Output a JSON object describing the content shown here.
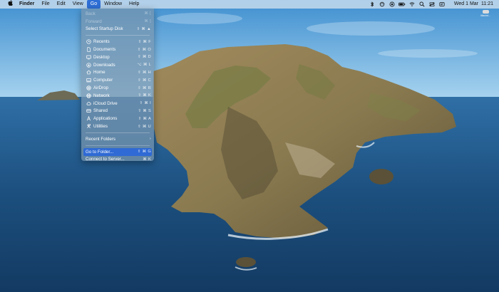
{
  "menubar": {
    "apple_icon": "apple-icon",
    "app_name": "Finder",
    "menus": [
      "File",
      "Edit",
      "View",
      "Go",
      "Window",
      "Help"
    ],
    "active_menu": "Go",
    "status_icons": [
      "bluetooth-icon",
      "siri-icon",
      "screen-record-icon",
      "battery-icon",
      "wifi-icon",
      "search-icon",
      "control-center-icon",
      "notification-icon"
    ],
    "date": "Wed 1 Mar",
    "time": "11:21"
  },
  "go_menu": {
    "items": [
      {
        "label": "Back",
        "shortcut": "⌘ [",
        "icon": "",
        "enabled": false
      },
      {
        "label": "Forward",
        "shortcut": "⌘ ]",
        "icon": "",
        "enabled": false
      },
      {
        "label": "Select Startup Disk",
        "shortcut": "⇧ ⌘ ▲",
        "icon": "",
        "enabled": true
      },
      {
        "sep": true
      },
      {
        "label": "Recents",
        "shortcut": "⇧ ⌘ F",
        "icon": "clock-icon",
        "enabled": true
      },
      {
        "label": "Documents",
        "shortcut": "⇧ ⌘ O",
        "icon": "document-icon",
        "enabled": true
      },
      {
        "label": "Desktop",
        "shortcut": "⇧ ⌘ D",
        "icon": "desktop-icon",
        "enabled": true
      },
      {
        "label": "Downloads",
        "shortcut": "⌥ ⌘ L",
        "icon": "download-icon",
        "enabled": true
      },
      {
        "label": "Home",
        "shortcut": "⇧ ⌘ H",
        "icon": "home-icon",
        "enabled": true
      },
      {
        "label": "Computer",
        "shortcut": "⇧ ⌘ C",
        "icon": "computer-icon",
        "enabled": true
      },
      {
        "label": "AirDrop",
        "shortcut": "⇧ ⌘ R",
        "icon": "airdrop-icon",
        "enabled": true
      },
      {
        "label": "Network",
        "shortcut": "⇧ ⌘ K",
        "icon": "network-icon",
        "enabled": true
      },
      {
        "label": "iCloud Drive",
        "shortcut": "⇧ ⌘ I",
        "icon": "cloud-icon",
        "enabled": true
      },
      {
        "label": "Shared",
        "shortcut": "⇧ ⌘ S",
        "icon": "shared-icon",
        "enabled": true
      },
      {
        "label": "Applications",
        "shortcut": "⇧ ⌘ A",
        "icon": "applications-icon",
        "enabled": true
      },
      {
        "label": "Utilities",
        "shortcut": "⇧ ⌘ U",
        "icon": "utilities-icon",
        "enabled": true
      },
      {
        "sep": true
      },
      {
        "label": "Recent Folders",
        "shortcut": "›",
        "icon": "",
        "enabled": true
      },
      {
        "sep": true
      },
      {
        "label": "Go to Folder...",
        "shortcut": "⇧ ⌘ G",
        "icon": "",
        "enabled": true,
        "highlighted": true
      },
      {
        "label": "Connect to Server...",
        "shortcut": "⌘ K",
        "icon": "",
        "enabled": true
      }
    ]
  },
  "desktop_icon": {
    "icon": "disk-icon",
    "label": "Macint..."
  },
  "colors": {
    "highlight": "#2f6ad5",
    "menubar_bg": "#d2e1f0"
  }
}
